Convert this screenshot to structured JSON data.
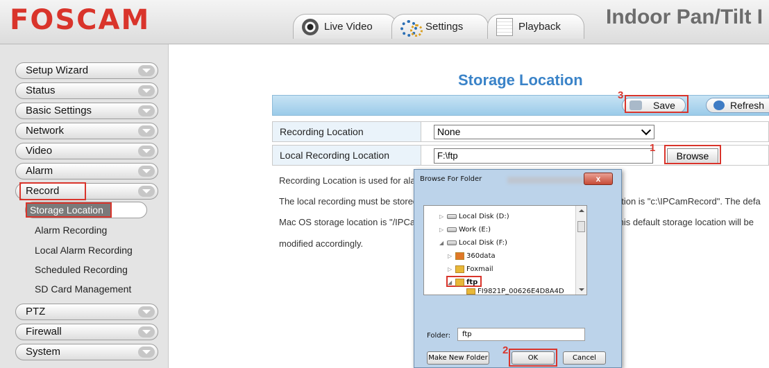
{
  "header": {
    "logo": "FOSCAM",
    "product": "Indoor Pan/Tilt I",
    "tabs": [
      {
        "label": "Live Video",
        "icon": "eye-icon"
      },
      {
        "label": "Settings",
        "icon": "gear-icon"
      },
      {
        "label": "Playback",
        "icon": "calendar-icon"
      }
    ]
  },
  "sidebar": {
    "items": [
      {
        "label": "Setup Wizard"
      },
      {
        "label": "Status"
      },
      {
        "label": "Basic Settings"
      },
      {
        "label": "Network"
      },
      {
        "label": "Video"
      },
      {
        "label": "Alarm"
      },
      {
        "label": "Record",
        "expanded": true
      },
      {
        "label": "PTZ"
      },
      {
        "label": "Firewall"
      },
      {
        "label": "System"
      }
    ],
    "record_subitems": [
      {
        "label": "Storage Location",
        "active": true
      },
      {
        "label": "Alarm Recording"
      },
      {
        "label": "Local Alarm Recording"
      },
      {
        "label": "Scheduled Recording"
      },
      {
        "label": "SD Card Management"
      }
    ]
  },
  "main": {
    "title": "Storage Location",
    "toolbar": {
      "save_label": "Save",
      "refresh_label": "Refresh"
    },
    "fields": [
      {
        "label": "Recording Location",
        "value": "None",
        "type": "select"
      },
      {
        "label": "Local Recording Location",
        "value": "F:\\ftp",
        "type": "text",
        "button": "Browse"
      }
    ],
    "paragraph": [
      "Recording Location is used for ala",
      "The local recording must be stored",
      "Mac OS storage location is \"/IPCa",
      "modified accordingly."
    ],
    "paragraph_right": [
      "ation is \"c:\\IPCamRecord\". The defa",
      "this default storage location will be"
    ]
  },
  "steps": {
    "one": "1",
    "two": "2",
    "three": "3"
  },
  "dialog": {
    "title": "Browse For Folder",
    "close_label": "x",
    "tree": [
      {
        "label": "Local Disk (D:)",
        "icon": "drive-icon",
        "expander": "▷"
      },
      {
        "label": "Work (E:)",
        "icon": "drive-icon",
        "expander": "▷"
      },
      {
        "label": "Local Disk (F:)",
        "icon": "drive-icon",
        "expander": "◢"
      },
      {
        "label": "360data",
        "icon": "folder-icon",
        "expander": "▷"
      },
      {
        "label": "Foxmail",
        "icon": "folder-icon",
        "expander": "▷"
      },
      {
        "label": "ftp",
        "icon": "folder-icon",
        "expander": "◢",
        "selected": true
      },
      {
        "label": "FI9821P_00626E4D8A4D",
        "icon": "folder-icon",
        "expander": ""
      }
    ],
    "folder_label": "Folder:",
    "folder_value": "ftp",
    "new_folder_label": "Make New Folder",
    "ok_label": "OK",
    "cancel_label": "Cancel"
  },
  "colors": {
    "brand": "#d9342b",
    "accent": "#3a83c8",
    "highlight": "#d9342b"
  }
}
